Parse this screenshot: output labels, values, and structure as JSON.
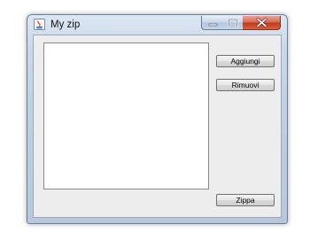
{
  "window": {
    "title": "My zip",
    "controls": {
      "minimize": "minimize-icon",
      "maximize": "maximize-icon",
      "close": "close-icon"
    }
  },
  "main": {
    "file_list": {
      "items": []
    },
    "buttons": {
      "add_label": "Aggiungi",
      "remove_label": "Rimuovi",
      "zip_label": "Zippa"
    }
  },
  "colors": {
    "close_button": "#c0391b",
    "frame": "#bccde2"
  }
}
